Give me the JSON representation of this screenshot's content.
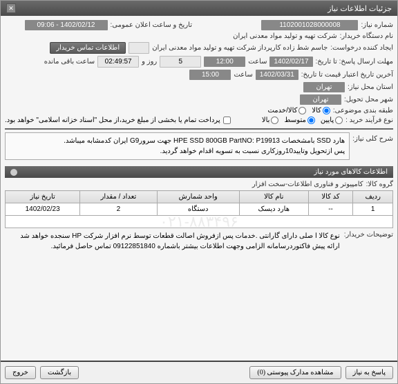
{
  "window_title": "جزئیات اطلاعات نیاز",
  "fields": {
    "need_no_label": "شماره نیاز:",
    "need_no": "1102001028000008",
    "announce_label": "تاریخ و ساعت اعلان عمومی:",
    "announce": "1402/02/12 - 09:06",
    "buyer_org_label": "نام دستگاه خریدار:",
    "buyer_org": "شرکت تهیه و تولید مواد معدنی ایران",
    "requester_label": "ایجاد کننده درخواست:",
    "requester": "جاسم شط زاده کارپرداز شرکت تهیه و تولید مواد معدنی ایران",
    "contact_btn": "اطلاعات تماس خریدار",
    "deadline_label": "مهلت ارسال پاسخ: تا تاریخ:",
    "deadline_date": "1402/02/17",
    "deadline_time_label": "ساعت",
    "deadline_time": "12:00",
    "days": "5",
    "days_label": "روز و",
    "countdown": "02:49:57",
    "remaining_label": "ساعت باقی مانده",
    "validity_label": "آخرین تاریخ اعتبار قیمت تا تاریخ:",
    "validity_date": "1402/03/31",
    "validity_time_label": "ساعت",
    "validity_time": "15:00",
    "need_loc_label": "استان محل نیاز:",
    "need_loc": "تهران",
    "deliver_loc_label": "شهر محل تحویل:",
    "deliver_loc": "تهران",
    "pack_label": "طبقه بندی موضوعی:",
    "pack_value": "کالا",
    "pack_opt2": "کالا/خدمت",
    "purchase_type_label": "نوع فرآیند خرید :",
    "pt_low": "پایین",
    "pt_mid": "متوسط",
    "pt_high": "بالا",
    "payment_label": "پرداخت تمام یا بخشی از مبلغ خرید،از محل \"اسناد خزانه اسلامی\" خواهد بود."
  },
  "description": {
    "label": "شرح کلی نیاز:",
    "line1": "هارد SSD بامشخصات  HPE SSD 800GB PartNO: P19913  جهت سرورG9 ایران کدمشابه میباشد.",
    "line2": "پس ازتحویل وتایید10روزکاری نسبت به تسویه اقدام خواهد گردید."
  },
  "items_section_title": "اطلاعات کالاهای مورد نیاز",
  "goods_group_label": "گروه کالا:",
  "goods_group": "کامپیوتر و فناوری اطلاعات-سخت افزار",
  "table": {
    "headers": [
      "ردیف",
      "کد کالا",
      "نام کالا",
      "واحد شمارش",
      "تعداد / مقدار",
      "تاریخ نیاز"
    ],
    "row": {
      "idx": "1",
      "code": "--",
      "name": "هارد دیسک",
      "unit": "دستگاه",
      "qty": "2",
      "date": "1402/02/23"
    }
  },
  "buyer_notes": {
    "label": "توضیحات خریدار:",
    "text": "نوع کالا  ا صلی دارای گارانتی .خدمات پس ازفروش اصالت قطعات توسط نرم افزار شرکت HP سنجده خواهد شد\nارائه پیش فاکتوردرسامانه الزامی وجهت اطلاعات بیشتر باشماره 09122851840 تماس حاصل فرمائید."
  },
  "footer": {
    "attach_btn": "مشاهده مدارک پیوستی (0)",
    "respond_btn": "پاسخ به نیاز",
    "back_btn": "بازگشت",
    "exit_btn": "خروج"
  },
  "watermark": "۰۲۱-۸۸۳۴۹۶"
}
